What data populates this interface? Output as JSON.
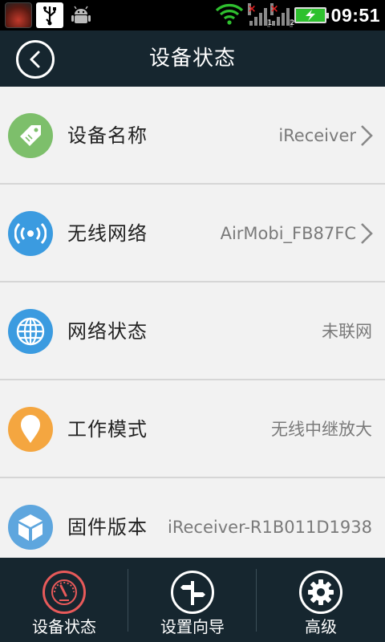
{
  "status_bar": {
    "time": "09:51",
    "sim1_badge": "1",
    "sim2_badge": "2"
  },
  "header": {
    "title": "设备状态"
  },
  "rows": [
    {
      "label": "设备名称",
      "value": "iReceiver",
      "icon": "tag-icon",
      "color": "#7dbf6b",
      "chevron": true
    },
    {
      "label": "无线网络",
      "value": "AirMobi_FB87FC",
      "icon": "wireless-icon",
      "color": "#3b9be0",
      "chevron": true
    },
    {
      "label": "网络状态",
      "value": "未联网",
      "icon": "globe-icon",
      "color": "#3b9be0",
      "chevron": false
    },
    {
      "label": "工作模式",
      "value": "无线中继放大",
      "icon": "location-pin-icon",
      "color": "#f4a640",
      "chevron": false
    },
    {
      "label": "固件版本",
      "value": "iReceiver-R1B011D1938",
      "icon": "package-icon",
      "color": "#5ea6de",
      "chevron": false
    }
  ],
  "bottom_nav": {
    "items": [
      {
        "label": "设备状态",
        "icon": "speedometer-icon",
        "accent": "#e85a5a",
        "active": true
      },
      {
        "label": "设置向导",
        "icon": "signpost-icon",
        "accent": "#ffffff",
        "active": false
      },
      {
        "label": "高级",
        "icon": "gear-icon",
        "accent": "#ffffff",
        "active": false
      }
    ]
  }
}
